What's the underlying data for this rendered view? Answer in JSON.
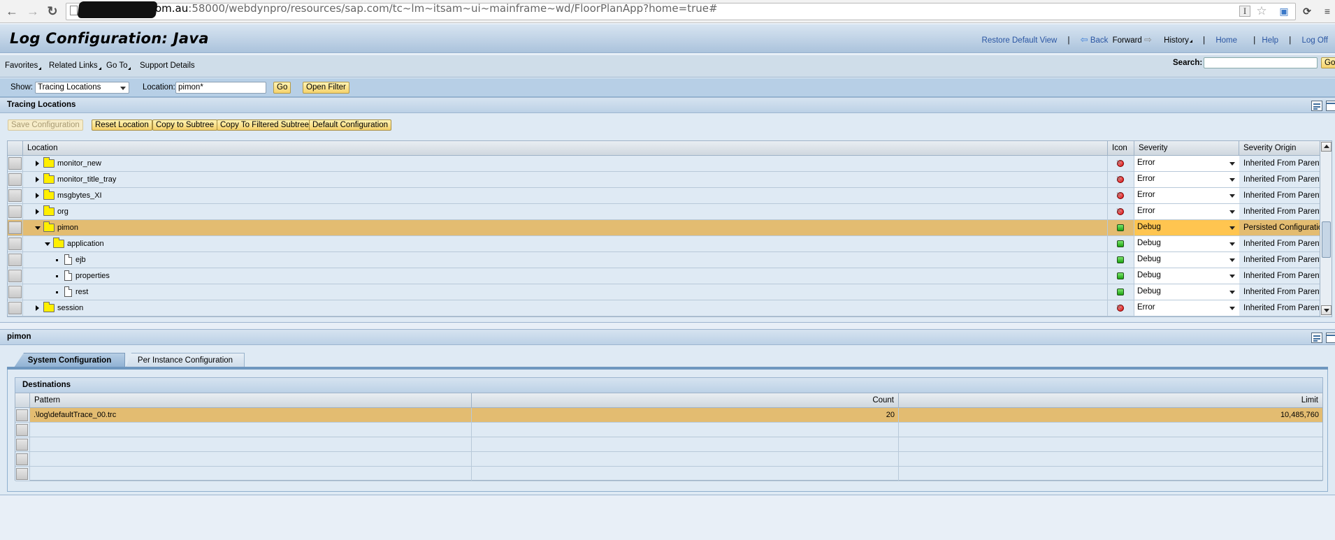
{
  "browser": {
    "url_host_suffix": "om.au",
    "url_rest": ":58000/webdynpro/resources/sap.com/tc~lm~itsam~ui~mainframe~wd/FloorPlanApp?home=true#"
  },
  "header": {
    "title": "Log Configuration: Java",
    "links": {
      "restore_default_view": "Restore Default View",
      "back": "Back",
      "forward": "Forward",
      "history": "History",
      "home": "Home",
      "help": "Help",
      "log_off": "Log Off"
    }
  },
  "menu": {
    "items": [
      "Favorites",
      "Related Links",
      "Go To"
    ],
    "support_details": "Support Details",
    "search_label": "Search:",
    "search_value": "",
    "search_go": "Go"
  },
  "filter": {
    "show_label": "Show:",
    "show_value": "Tracing Locations",
    "location_label": "Location:",
    "location_value": "pimon*",
    "go_label": "Go",
    "open_filter_label": "Open Filter"
  },
  "tracing": {
    "panel_title": "Tracing Locations",
    "toolbar": {
      "save": "Save Configuration",
      "reset": "Reset Location",
      "copy_subtree": "Copy to Subtree",
      "copy_filtered": "Copy To Filtered Subtree",
      "default_config": "Default Configuration"
    },
    "columns": {
      "location": "Location",
      "icon": "Icon",
      "severity": "Severity",
      "origin": "Severity Origin"
    },
    "rows": [
      {
        "name": "monitor_new",
        "level": 0,
        "type": "folder",
        "expanded": false,
        "status": "error",
        "severity": "Error",
        "origin": "Inherited From Parent",
        "selected": false
      },
      {
        "name": "monitor_title_tray",
        "level": 0,
        "type": "folder",
        "expanded": false,
        "status": "error",
        "severity": "Error",
        "origin": "Inherited From Parent",
        "selected": false
      },
      {
        "name": "msgbytes_XI",
        "level": 0,
        "type": "folder",
        "expanded": false,
        "status": "error",
        "severity": "Error",
        "origin": "Inherited From Parent",
        "selected": false
      },
      {
        "name": "org",
        "level": 0,
        "type": "folder",
        "expanded": false,
        "status": "error",
        "severity": "Error",
        "origin": "Inherited From Parent",
        "selected": false
      },
      {
        "name": "pimon",
        "level": 0,
        "type": "folder",
        "expanded": true,
        "status": "ok",
        "severity": "Debug",
        "origin": "Persisted Configuration",
        "selected": true
      },
      {
        "name": "application",
        "level": 1,
        "type": "folder",
        "expanded": true,
        "status": "ok",
        "severity": "Debug",
        "origin": "Inherited From Parent",
        "selected": false
      },
      {
        "name": "ejb",
        "level": 2,
        "type": "leaf",
        "expanded": false,
        "status": "ok",
        "severity": "Debug",
        "origin": "Inherited From Parent",
        "selected": false
      },
      {
        "name": "properties",
        "level": 2,
        "type": "leaf",
        "expanded": false,
        "status": "ok",
        "severity": "Debug",
        "origin": "Inherited From Parent",
        "selected": false
      },
      {
        "name": "rest",
        "level": 2,
        "type": "leaf",
        "expanded": false,
        "status": "ok",
        "severity": "Debug",
        "origin": "Inherited From Parent",
        "selected": false
      },
      {
        "name": "session",
        "level": 0,
        "type": "folder",
        "expanded": false,
        "status": "error",
        "severity": "Error",
        "origin": "Inherited From Parent",
        "selected": false
      }
    ]
  },
  "detail": {
    "panel_title": "pimon",
    "tabs": [
      {
        "label": "System Configuration",
        "active": true
      },
      {
        "label": "Per Instance Configuration",
        "active": false
      }
    ],
    "destinations": {
      "title": "Destinations",
      "columns": {
        "pattern": "Pattern",
        "count": "Count",
        "limit": "Limit"
      },
      "rows": [
        {
          "pattern": ".\\log\\defaultTrace_00.trc",
          "count": "20",
          "limit": "10,485,760",
          "selected": true
        },
        {
          "pattern": "",
          "count": "",
          "limit": "",
          "selected": false
        },
        {
          "pattern": "",
          "count": "",
          "limit": "",
          "selected": false
        },
        {
          "pattern": "",
          "count": "",
          "limit": "",
          "selected": false
        },
        {
          "pattern": "",
          "count": "",
          "limit": "",
          "selected": false
        }
      ]
    }
  },
  "colors": {
    "selected_row": "#e3bc71",
    "selected_severity": "#ffc550",
    "link": "#2a55a2",
    "button": "#f4d06a"
  }
}
